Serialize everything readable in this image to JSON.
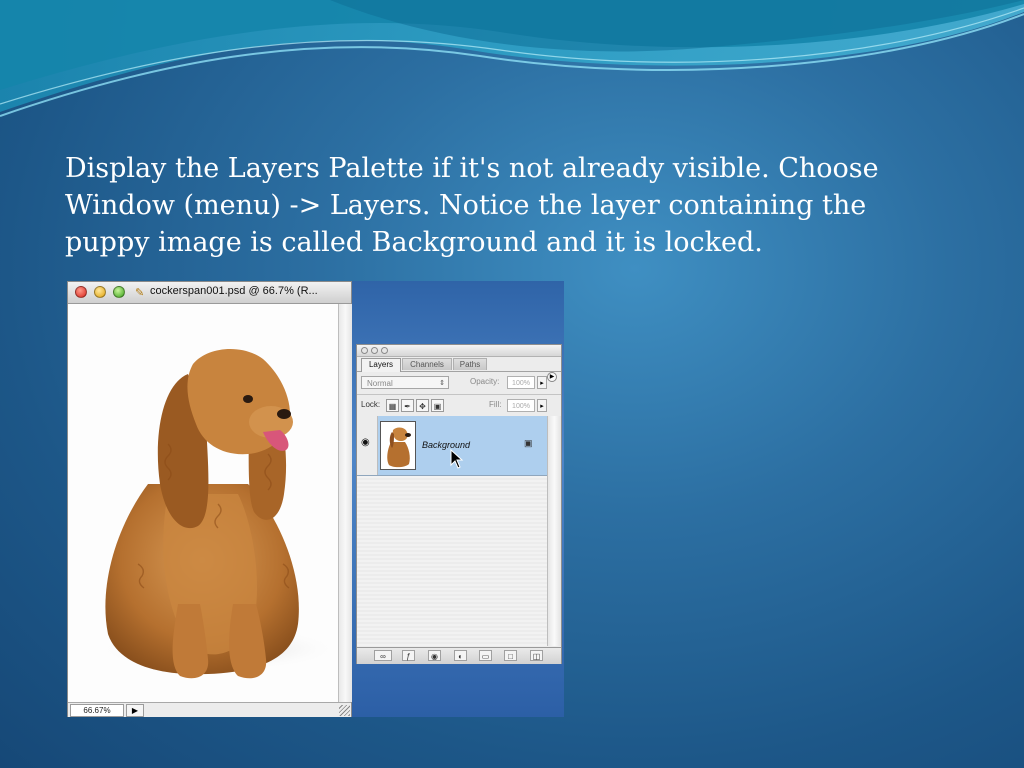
{
  "slide": {
    "text": "Display the Layers Palette if it's not already visible. Choose Window (menu) -> Layers. Notice the layer containing the puppy image is called Background and it is locked."
  },
  "document_window": {
    "title": "cockerspan001.psd @ 66.7% (R...",
    "zoom": "66.67%",
    "icons": [
      "close-button",
      "minimize-button",
      "zoom-button",
      "psd-file-icon",
      "status-arrow-icon"
    ]
  },
  "layers_palette": {
    "tabs": [
      {
        "label": "Layers",
        "active": true
      },
      {
        "label": "Channels",
        "active": false
      },
      {
        "label": "Paths",
        "active": false
      }
    ],
    "blend_mode": "Normal",
    "opacity_label": "Opacity:",
    "opacity_value": "100%",
    "lock_label": "Lock:",
    "fill_label": "Fill:",
    "fill_value": "100%",
    "layers": [
      {
        "name": "Background",
        "visible": true,
        "locked": true,
        "selected": true
      }
    ],
    "bottom_icons": [
      "link-layers-icon",
      "layer-style-icon",
      "layer-mask-icon",
      "adjustment-layer-icon",
      "new-group-icon",
      "new-layer-icon",
      "trash-icon"
    ]
  },
  "colors": {
    "slide_bg": "#1d5788",
    "text": "#ffffff",
    "selected_layer": "#aecfee"
  }
}
